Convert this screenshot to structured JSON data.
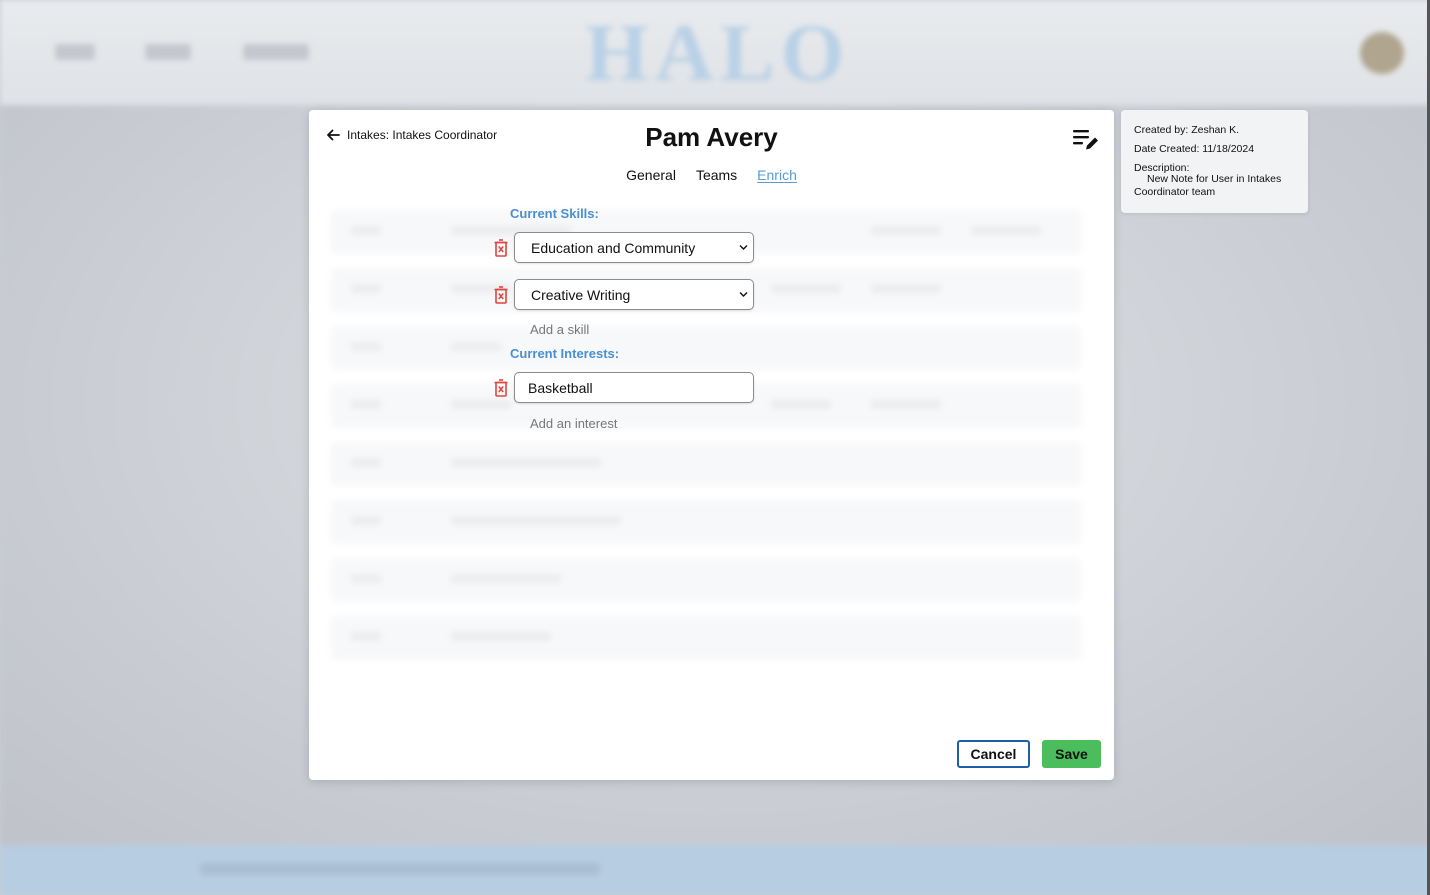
{
  "background": {
    "logo": "HALO"
  },
  "modal": {
    "back_label": "Intakes: Intakes Coordinator",
    "title": "Pam Avery",
    "tabs": [
      {
        "label": "General",
        "active": false
      },
      {
        "label": "Teams",
        "active": false
      },
      {
        "label": "Enrich",
        "active": true
      }
    ],
    "skills": {
      "heading": "Current Skills:",
      "items": [
        "Education and Community",
        "Creative Writing"
      ],
      "add_label": "Add a skill"
    },
    "interests": {
      "heading": "Current Interests:",
      "items": [
        "Basketball"
      ],
      "add_label": "Add an interest"
    },
    "cancel_label": "Cancel",
    "save_label": "Save"
  },
  "note": {
    "created_by": "Created by: Zeshan K.",
    "date_created": "Date Created: 11/18/2024",
    "description_label": "Description:",
    "description_text": "New Note for User in Intakes Coordinator team"
  },
  "colors": {
    "accent_blue": "#4a90d0",
    "save_green": "#4bbd5c",
    "cancel_border": "#1e5fa8",
    "trash_red": "#e0443e"
  }
}
